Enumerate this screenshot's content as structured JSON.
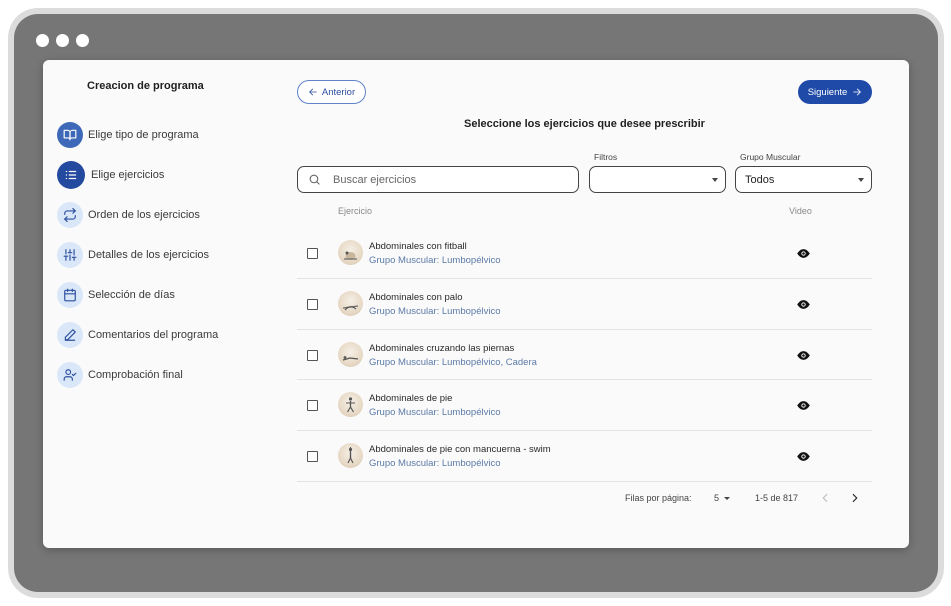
{
  "sidebar": {
    "title": "Creacion de programa",
    "items": [
      {
        "label": "Elige tipo de programa",
        "icon": "book-icon",
        "state": "done"
      },
      {
        "label": "Elige ejercicios",
        "icon": "list-icon",
        "state": "active"
      },
      {
        "label": "Orden de los ejercicios",
        "icon": "repeat-icon",
        "state": "pending"
      },
      {
        "label": "Detalles de los ejercicios",
        "icon": "sliders-icon",
        "state": "pending"
      },
      {
        "label": "Selección de días",
        "icon": "calendar-icon",
        "state": "pending"
      },
      {
        "label": "Comentarios del programa",
        "icon": "pen-icon",
        "state": "pending"
      },
      {
        "label": "Comprobación final",
        "icon": "user-check-icon",
        "state": "pending"
      }
    ]
  },
  "nav": {
    "prev_label": "Anterior",
    "next_label": "Siguiente"
  },
  "main": {
    "title": "Seleccione los ejercicios que desee prescribir",
    "search_placeholder": "Buscar ejercicios",
    "filters_label": "Filtros",
    "filters_value": "",
    "group_label": "Grupo Muscular",
    "group_value": "Todos"
  },
  "table": {
    "col_exercise": "Ejercicio",
    "col_video": "Video",
    "rows": [
      {
        "name": "Abdominales con fitball",
        "group": "Grupo Muscular: Lumbopélvico"
      },
      {
        "name": "Abdominales con palo",
        "group": "Grupo Muscular: Lumbopélvico"
      },
      {
        "name": "Abdominales cruzando las piernas",
        "group": "Grupo Muscular: Lumbopélvico, Cadera"
      },
      {
        "name": "Abdominales de pie",
        "group": "Grupo Muscular: Lumbopélvico"
      },
      {
        "name": "Abdominales de pie con mancuerna - swim",
        "group": "Grupo Muscular: Lumbopélvico"
      }
    ]
  },
  "pagination": {
    "rows_label": "Filas por página:",
    "rows_value": "5",
    "range": "1-5 de 817"
  },
  "colors": {
    "primary": "#1f4aa8",
    "accent_light": "#d9e7f8",
    "group_text": "#5b7aa8"
  }
}
